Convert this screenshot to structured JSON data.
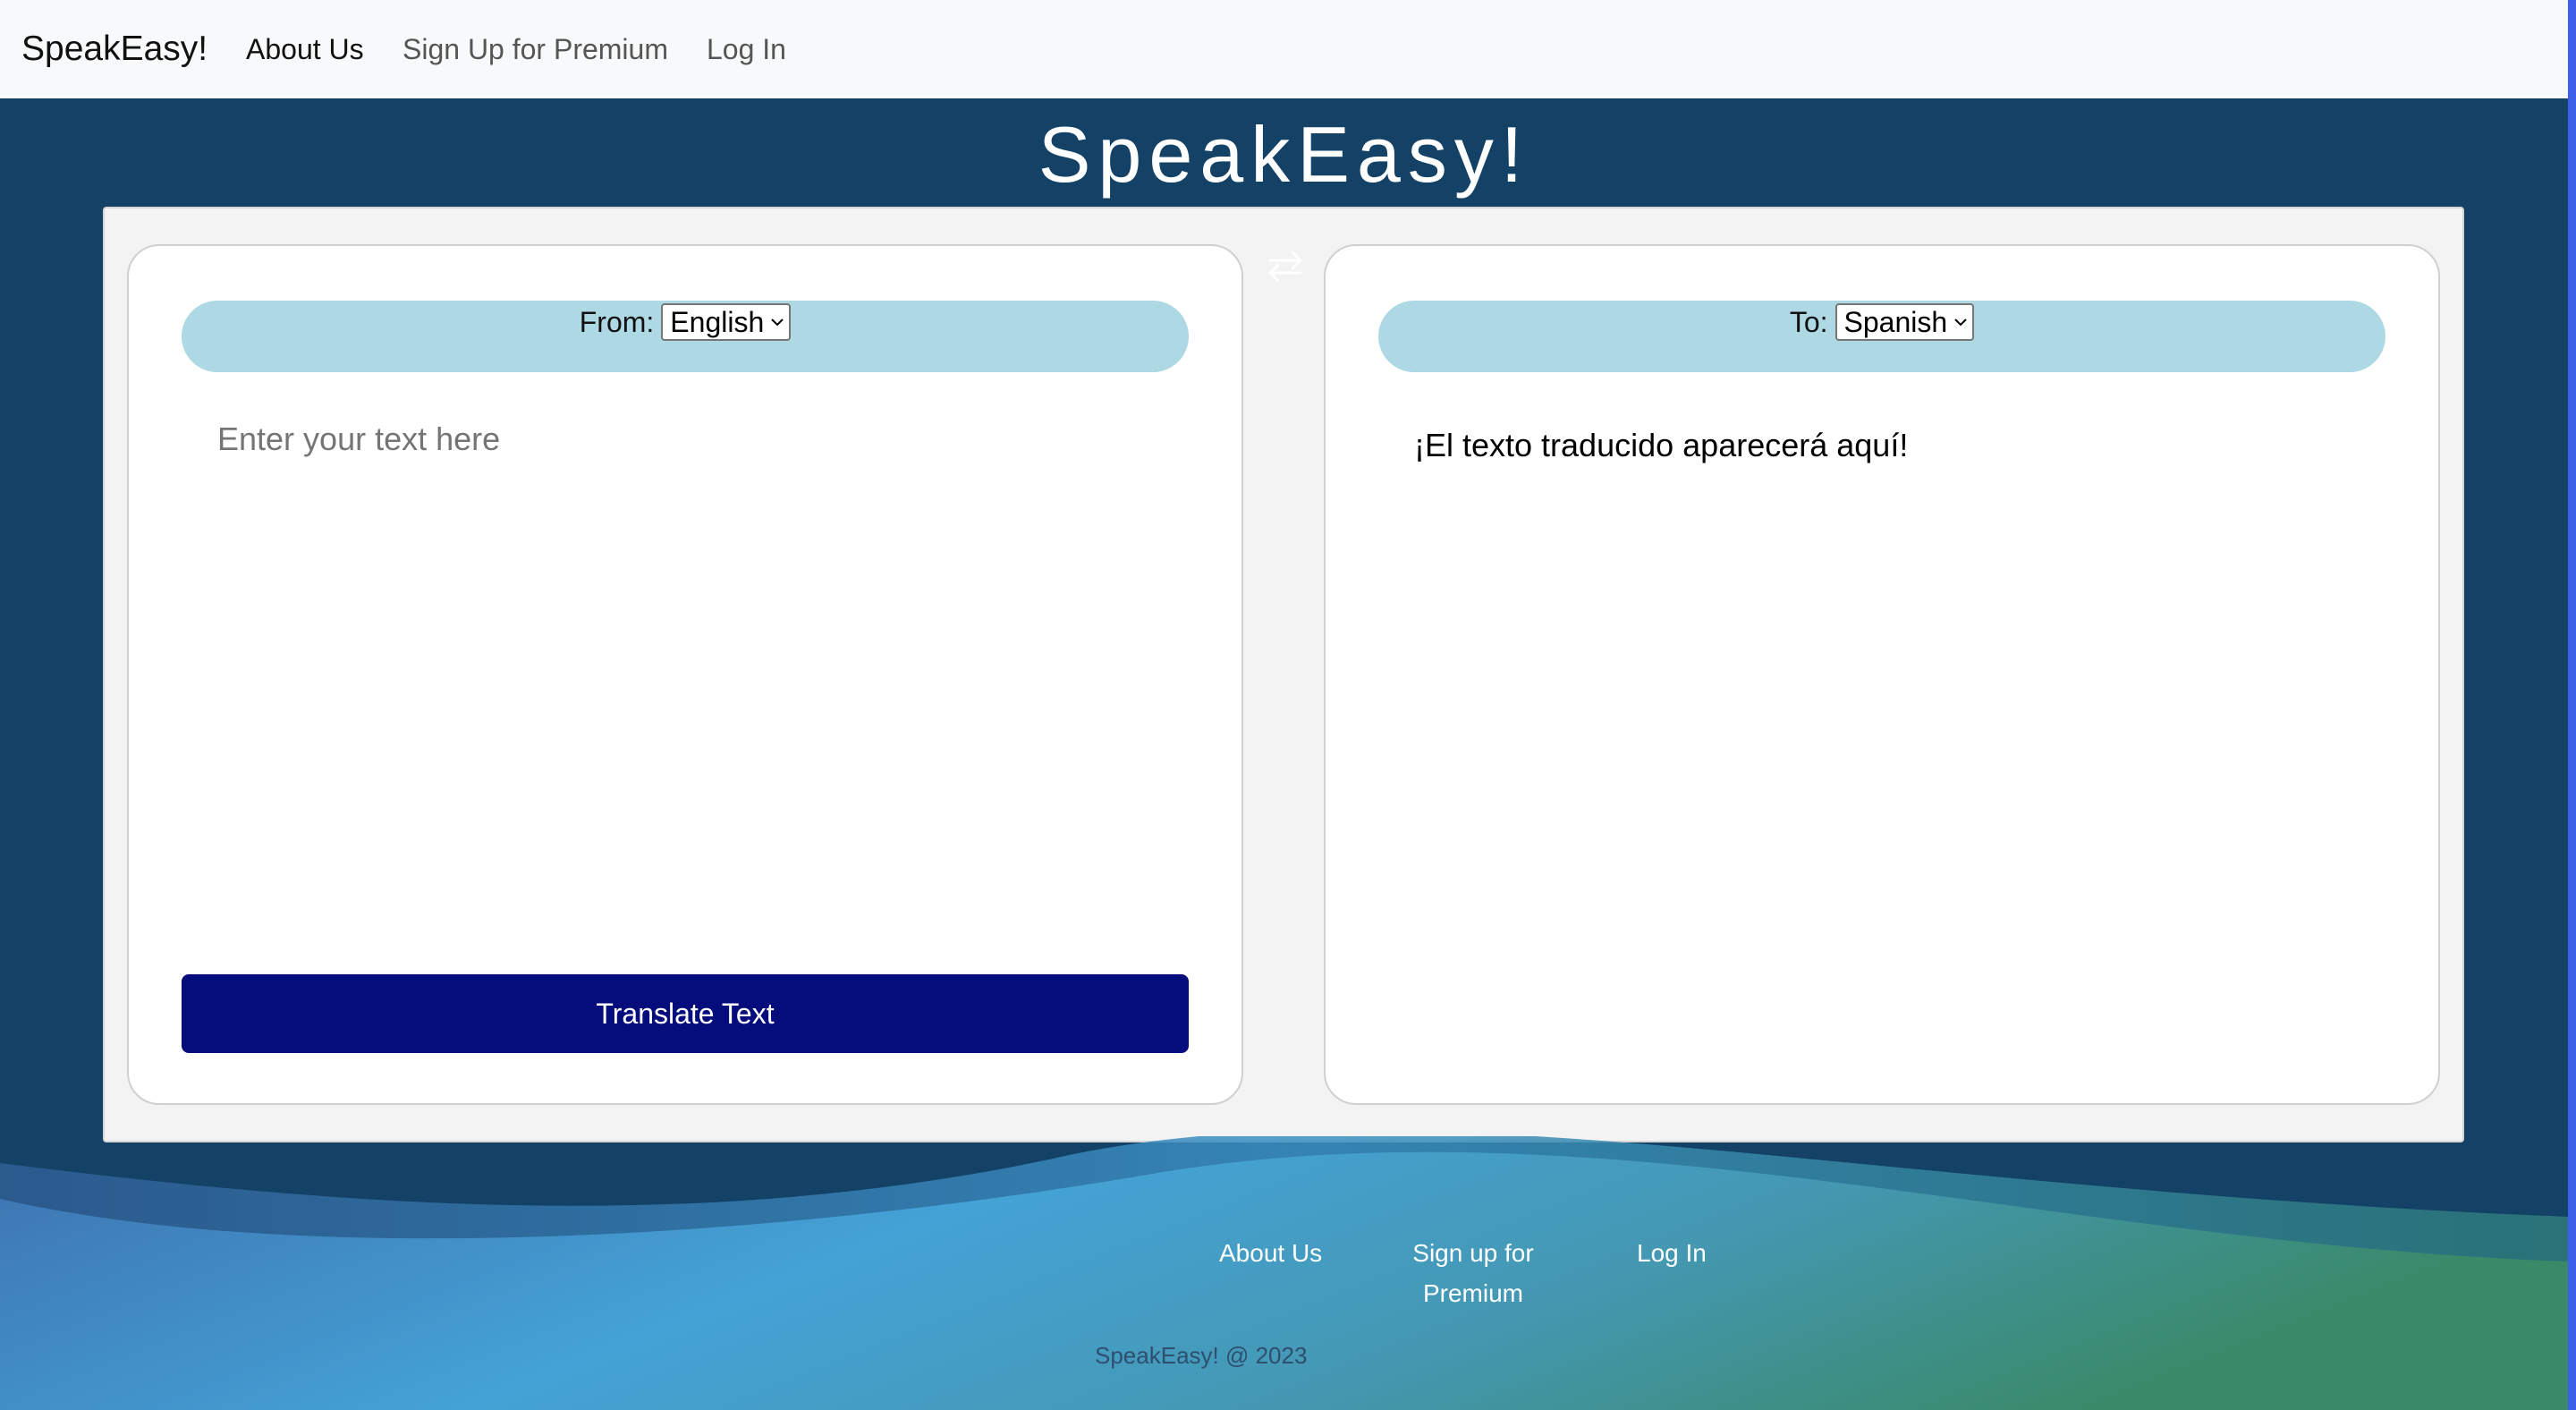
{
  "navbar": {
    "brand": "SpeakEasy!",
    "links": [
      {
        "label": "About Us"
      },
      {
        "label": "Sign Up for Premium"
      },
      {
        "label": "Log In"
      }
    ]
  },
  "hero": {
    "title": "SpeakEasy!"
  },
  "translator": {
    "source": {
      "label": "From:",
      "selected_language": "English"
    },
    "target": {
      "label": "To:",
      "selected_language": "Spanish"
    },
    "input": {
      "placeholder": "Enter your text here",
      "value": ""
    },
    "output_text": "¡El texto traducido aparecerá aquí!",
    "translate_button_label": "Translate Text",
    "swap_icon": "swap-arrows-icon"
  },
  "footer": {
    "links": [
      {
        "label": "About Us"
      },
      {
        "label_line1": "Sign up for",
        "label_line2": "Premium"
      },
      {
        "label": "Log In"
      }
    ],
    "copyright": "SpeakEasy! @ 2023"
  },
  "colors": {
    "page_background": "#134266",
    "navbar_background": "#f8f9fa",
    "language_bar": "#add8e4",
    "translate_button": "#050c7c",
    "footer_gradient_left": "#3e73b0",
    "footer_gradient_mid": "#44a2d6",
    "footer_gradient_right": "#3a8a6a"
  }
}
